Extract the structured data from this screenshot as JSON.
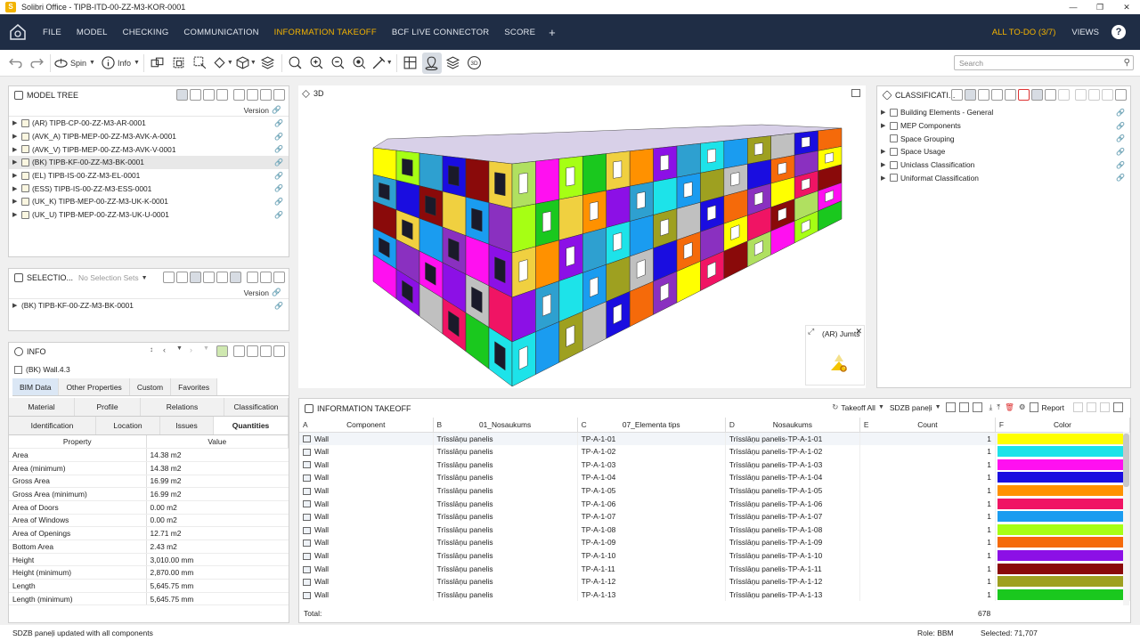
{
  "window": {
    "title": "Solibri Office - TIPB-ITD-00-ZZ-M3-KOR-0001",
    "app_icon": "S"
  },
  "menu": {
    "items": [
      "FILE",
      "MODEL",
      "CHECKING",
      "COMMUNICATION",
      "INFORMATION TAKEOFF",
      "BCF LIVE CONNECTOR",
      "SCORE"
    ],
    "active": "INFORMATION TAKEOFF",
    "add": "+",
    "todo": "ALL TO-DO (3/7)",
    "views": "VIEWS",
    "help": "?"
  },
  "toolbar": {
    "spin": "Spin",
    "info": "Info",
    "search_placeholder": "Search"
  },
  "model_tree": {
    "title": "MODEL TREE",
    "version_label": "Version",
    "items": [
      "(AR) TIPB-CP-00-ZZ-M3-AR-0001",
      "(AVK_A) TIPB-MEP-00-ZZ-M3-AVK-A-0001",
      "(AVK_V) TIPB-MEP-00-ZZ-M3-AVK-V-0001",
      "(BK) TIPB-KF-00-ZZ-M3-BK-0001",
      "(EL) TIPB-IS-00-ZZ-M3-EL-0001",
      "(ESS) TIPB-IS-00-ZZ-M3-ESS-0001",
      "(UK_K) TIPB-MEP-00-ZZ-M3-UK-K-0001",
      "(UK_U) TIPB-MEP-00-ZZ-M3-UK-U-0001"
    ],
    "selected_index": 3
  },
  "selection": {
    "title": "SELECTIO...",
    "dropdown": "No Selection Sets",
    "version_label": "Version",
    "items": [
      "(BK) TIPB-KF-00-ZZ-M3-BK-0001"
    ]
  },
  "info": {
    "title": "INFO",
    "object": "(BK) Wall.4.3",
    "tabs": [
      "BIM Data",
      "Other Properties",
      "Custom",
      "Favorites"
    ],
    "active_tab": "BIM Data",
    "subtabs_row1": [
      "Material",
      "Profile",
      "Relations",
      "Classification"
    ],
    "subtabs_row2": [
      "Identification",
      "Location",
      "Issues",
      "Quantities"
    ],
    "active_subtab": "Quantities",
    "headers": [
      "Property",
      "Value"
    ],
    "rows": [
      [
        "Area",
        "14.38 m2"
      ],
      [
        "Area (minimum)",
        "14.38 m2"
      ],
      [
        "Gross Area",
        "16.99 m2"
      ],
      [
        "Gross Area (minimum)",
        "16.99 m2"
      ],
      [
        "Area of Doors",
        "0.00 m2"
      ],
      [
        "Area of Windows",
        "0.00 m2"
      ],
      [
        "Area of Openings",
        "12.71 m2"
      ],
      [
        "Bottom Area",
        "2.43 m2"
      ],
      [
        "Height",
        "3,010.00 mm"
      ],
      [
        "Height (minimum)",
        "2,870.00 mm"
      ],
      [
        "Length",
        "5,645.75 mm"
      ],
      [
        "Length (minimum)",
        "5,645.75 mm"
      ]
    ]
  },
  "view3d": {
    "title": "3D",
    "minimap_label": "(AR) Jumts"
  },
  "classification": {
    "title": "CLASSIFICATI...",
    "items": [
      {
        "label": "Building Elements - General",
        "expandable": true
      },
      {
        "label": "MEP Components",
        "expandable": true
      },
      {
        "label": "Space Grouping",
        "expandable": false
      },
      {
        "label": "Space Usage",
        "expandable": true
      },
      {
        "label": "Uniclass Classification",
        "expandable": true
      },
      {
        "label": "Uniformat Classification",
        "expandable": true
      }
    ]
  },
  "takeoff": {
    "title": "INFORMATION TAKEOFF",
    "takeoff_all": "Takeoff All",
    "definition": "SDZB paneļi",
    "report": "Report",
    "columns": [
      {
        "letter": "A",
        "name": "Component"
      },
      {
        "letter": "B",
        "name": "01_Nosaukums"
      },
      {
        "letter": "C",
        "name": "07_Elementa tips"
      },
      {
        "letter": "D",
        "name": "Nosaukums"
      },
      {
        "letter": "E",
        "name": "Count"
      },
      {
        "letter": "F",
        "name": "Color"
      }
    ],
    "rows": [
      {
        "component": "Wall",
        "nosaukums01": "Trīsslāņu panelis",
        "tips": "TP-A-1-01",
        "nosaukums": "Trīsslāņu panelis-TP-A-1-01",
        "count": "1",
        "color": "#ffff00"
      },
      {
        "component": "Wall",
        "nosaukums01": "Trīsslāņu panelis",
        "tips": "TP-A-1-02",
        "nosaukums": "Trīsslāņu panelis-TP-A-1-02",
        "count": "1",
        "color": "#1de3e9"
      },
      {
        "component": "Wall",
        "nosaukums01": "Trīsslāņu panelis",
        "tips": "TP-A-1-03",
        "nosaukums": "Trīsslāņu panelis-TP-A-1-03",
        "count": "1",
        "color": "#ff10f0"
      },
      {
        "component": "Wall",
        "nosaukums01": "Trīsslāņu panelis",
        "tips": "TP-A-1-04",
        "nosaukums": "Trīsslāņu panelis-TP-A-1-04",
        "count": "1",
        "color": "#1a0de0"
      },
      {
        "component": "Wall",
        "nosaukums01": "Trīsslāņu panelis",
        "tips": "TP-A-1-05",
        "nosaukums": "Trīsslāņu panelis-TP-A-1-05",
        "count": "1",
        "color": "#ff9100"
      },
      {
        "component": "Wall",
        "nosaukums01": "Trīsslāņu panelis",
        "tips": "TP-A-1-06",
        "nosaukums": "Trīsslāņu panelis-TP-A-1-06",
        "count": "1",
        "color": "#f01464"
      },
      {
        "component": "Wall",
        "nosaukums01": "Trīsslāņu panelis",
        "tips": "TP-A-1-07",
        "nosaukums": "Trīsslāņu panelis-TP-A-1-07",
        "count": "1",
        "color": "#1a9cf0"
      },
      {
        "component": "Wall",
        "nosaukums01": "Trīsslāņu panelis",
        "tips": "TP-A-1-08",
        "nosaukums": "Trīsslāņu panelis-TP-A-1-08",
        "count": "1",
        "color": "#a6ff14"
      },
      {
        "component": "Wall",
        "nosaukums01": "Trīsslāņu panelis",
        "tips": "TP-A-1-09",
        "nosaukums": "Trīsslāņu panelis-TP-A-1-09",
        "count": "1",
        "color": "#f56a0a"
      },
      {
        "component": "Wall",
        "nosaukums01": "Trīsslāņu panelis",
        "tips": "TP-A-1-10",
        "nosaukums": "Trīsslāņu panelis-TP-A-1-10",
        "count": "1",
        "color": "#8c10e6"
      },
      {
        "component": "Wall",
        "nosaukums01": "Trīsslāņu panelis",
        "tips": "TP-A-1-11",
        "nosaukums": "Trīsslāņu panelis-TP-A-1-11",
        "count": "1",
        "color": "#8a0a0a"
      },
      {
        "component": "Wall",
        "nosaukums01": "Trīsslāņu panelis",
        "tips": "TP-A-1-12",
        "nosaukums": "Trīsslāņu panelis-TP-A-1-12",
        "count": "1",
        "color": "#9ea020"
      },
      {
        "component": "Wall",
        "nosaukums01": "Trīsslāņu panelis",
        "tips": "TP-A-1-13",
        "nosaukums": "Trīsslāņu panelis-TP-A-1-13",
        "count": "1",
        "color": "#1ac81e"
      }
    ],
    "total_label": "Total:",
    "total_count": "678"
  },
  "status": {
    "message": "SDZB paneļi updated with all components",
    "role": "Role: BBM",
    "selected": "Selected: 71,707"
  },
  "icons": [
    "home-icon",
    "undo-icon",
    "redo-icon",
    "spin-icon",
    "info-icon",
    "search-icon",
    "link-icon",
    "expand-icon",
    "close-icon"
  ]
}
